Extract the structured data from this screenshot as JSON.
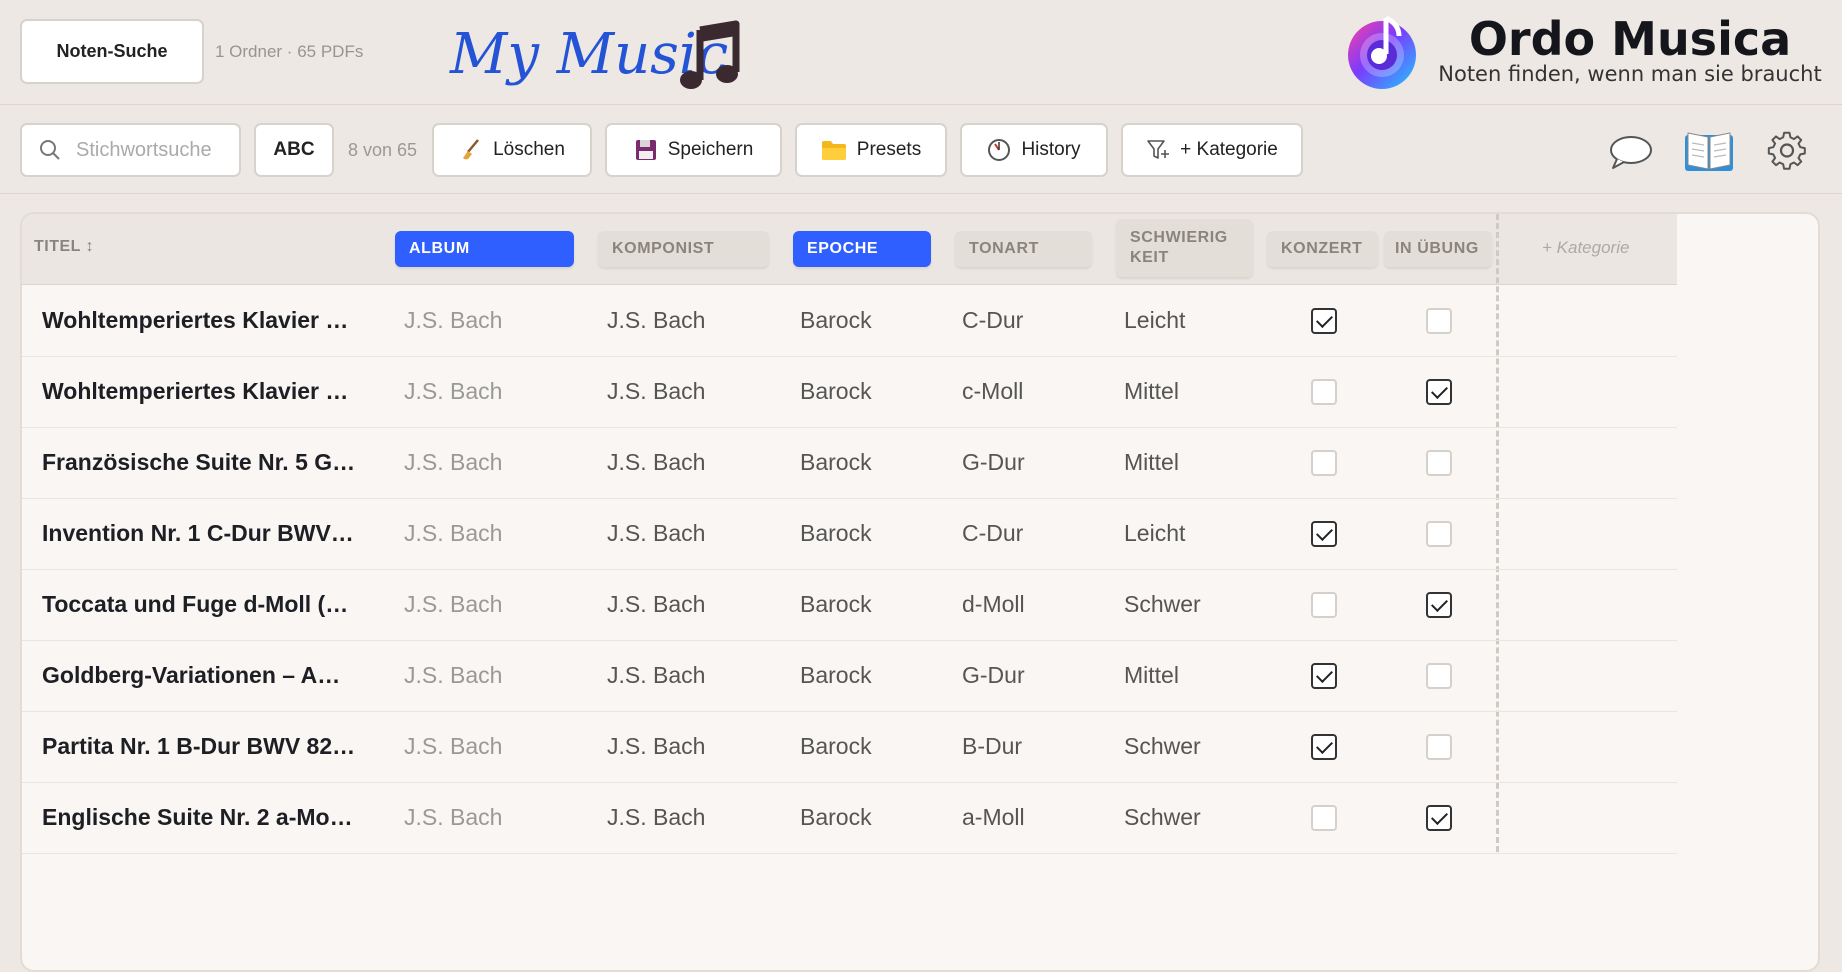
{
  "header": {
    "search_button": "Noten-Suche",
    "folder_count": "1 Ordner · 65 PDFs",
    "brand_script": "My Music",
    "app_name": "Ordo Musica",
    "tagline": "Noten finden, wenn man sie braucht"
  },
  "toolbar": {
    "search_placeholder": "Stichwortsuche",
    "abc_label": "ABC",
    "count": "8 von 65",
    "delete_label": "Löschen",
    "save_label": "Speichern",
    "presets_label": "Presets",
    "history_label": "History",
    "category_label": "+ Kategorie",
    "icons": [
      "search-icon",
      "broom-icon",
      "floppy-disk-icon",
      "folder-icon",
      "clock-icon",
      "filter-plus-icon",
      "chat-bubble-icon",
      "open-book-icon",
      "gear-icon"
    ]
  },
  "table": {
    "columns": {
      "title": "TITEL ↕",
      "album": "ALBUM",
      "komponist": "KOMPONIST",
      "epoche": "EPOCHE",
      "tonart": "TONART",
      "schwierigkeit": "SCHWIERIG KEIT",
      "konzert": "KONZERT",
      "in_uebung": "IN ÜBUNG",
      "add_category": "+ Kategorie"
    },
    "active_columns": [
      "album",
      "epoche"
    ],
    "accent_color": "#2f5fff",
    "rows": [
      {
        "title": "Wohltemperiertes Klavier …",
        "album": "J.S. Bach",
        "komponist": "J.S. Bach",
        "epoche": "Barock",
        "tonart": "C-Dur",
        "schwierigkeit": "Leicht",
        "konzert": true,
        "in_uebung": false
      },
      {
        "title": "Wohltemperiertes Klavier …",
        "album": "J.S. Bach",
        "komponist": "J.S. Bach",
        "epoche": "Barock",
        "tonart": "c-Moll",
        "schwierigkeit": "Mittel",
        "konzert": false,
        "in_uebung": true
      },
      {
        "title": "Französische Suite Nr. 5 G…",
        "album": "J.S. Bach",
        "komponist": "J.S. Bach",
        "epoche": "Barock",
        "tonart": "G-Dur",
        "schwierigkeit": "Mittel",
        "konzert": false,
        "in_uebung": false
      },
      {
        "title": "Invention Nr. 1 C-Dur BWV…",
        "album": "J.S. Bach",
        "komponist": "J.S. Bach",
        "epoche": "Barock",
        "tonart": "C-Dur",
        "schwierigkeit": "Leicht",
        "konzert": true,
        "in_uebung": false
      },
      {
        "title": "Toccata und Fuge d-Moll (…",
        "album": "J.S. Bach",
        "komponist": "J.S. Bach",
        "epoche": "Barock",
        "tonart": "d-Moll",
        "schwierigkeit": "Schwer",
        "konzert": false,
        "in_uebung": true
      },
      {
        "title": "Goldberg-Variationen – A…",
        "album": "J.S. Bach",
        "komponist": "J.S. Bach",
        "epoche": "Barock",
        "tonart": "G-Dur",
        "schwierigkeit": "Mittel",
        "konzert": true,
        "in_uebung": false
      },
      {
        "title": "Partita Nr. 1 B-Dur BWV 82…",
        "album": "J.S. Bach",
        "komponist": "J.S. Bach",
        "epoche": "Barock",
        "tonart": "B-Dur",
        "schwierigkeit": "Schwer",
        "konzert": true,
        "in_uebung": false
      },
      {
        "title": "Englische Suite Nr. 2 a-Mo…",
        "album": "J.S. Bach",
        "komponist": "J.S. Bach",
        "epoche": "Barock",
        "tonart": "a-Moll",
        "schwierigkeit": "Schwer",
        "konzert": false,
        "in_uebung": true
      }
    ]
  }
}
